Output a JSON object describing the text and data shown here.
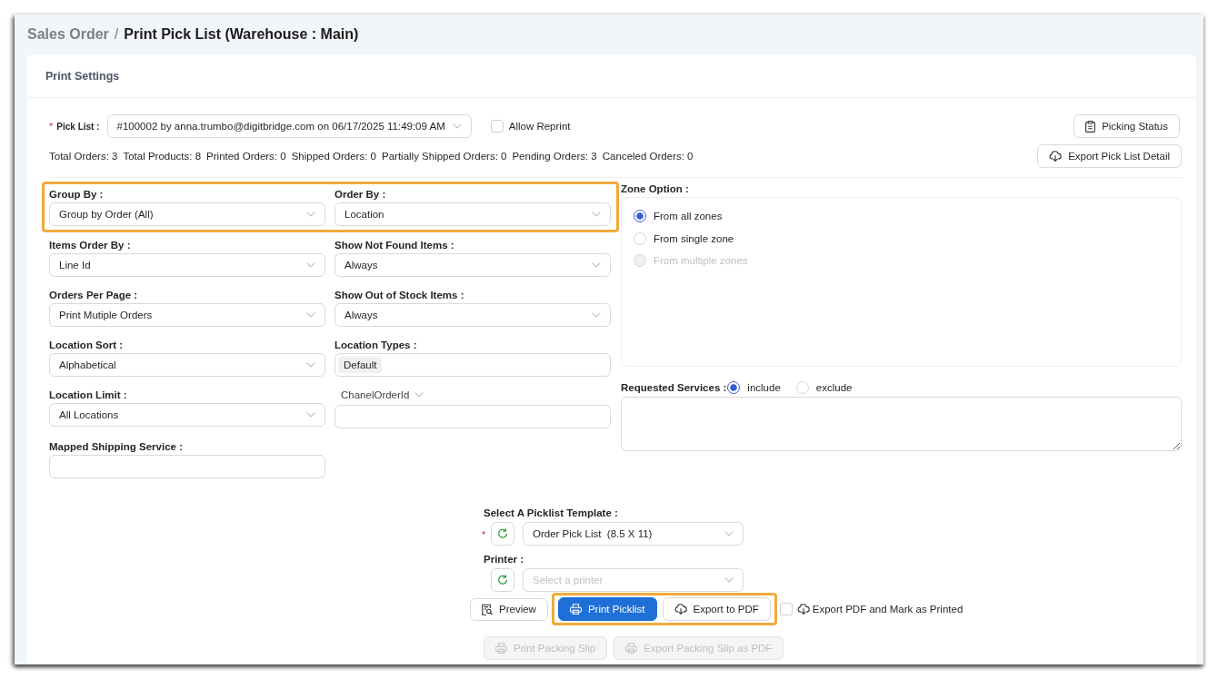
{
  "breadcrumb": {
    "parent": "Sales Order",
    "separator": "/",
    "current": "Print Pick List (Warehouse : Main)"
  },
  "panel": {
    "title": "Print Settings"
  },
  "pick_list": {
    "required_mark": "*",
    "label": "Pick List :",
    "value": "#100002 by anna.trumbo@digitbridge.com on 06/17/2025 11:49:09 AM"
  },
  "allow_reprint": {
    "label": "Allow Reprint",
    "checked": false
  },
  "picking_status_button": {
    "label": "Picking Status"
  },
  "stats": [
    "Total Orders: 3",
    "Total Products: 8",
    "Printed Orders: 0",
    "Shipped Orders: 0",
    "Partially Shipped Orders: 0",
    "Pending Orders: 3",
    "Canceled Orders: 0"
  ],
  "export_detail_button": {
    "label": "Export Pick List Detail"
  },
  "field_groups": [
    {
      "kind": "highlighted",
      "fields": [
        {
          "kind": "select",
          "label": "Group By :",
          "value": "Group by Order (All)"
        },
        {
          "kind": "select",
          "label": "Order By :",
          "value": "Location"
        }
      ]
    },
    {
      "kind": "plain",
      "fields": [
        {
          "kind": "select",
          "label": "Items Order By :",
          "value": "Line Id"
        },
        {
          "kind": "select",
          "label": "Show Not Found Items :",
          "value": "Always"
        },
        {
          "kind": "select",
          "label": "Orders Per Page :",
          "value": "Print Mutiple Orders"
        },
        {
          "kind": "select",
          "label": "Show Out of Stock Items :",
          "value": "Always"
        },
        {
          "kind": "select",
          "label": "Location Sort :",
          "value": "Alphabetical"
        },
        {
          "kind": "tags",
          "label": "Location Types :",
          "tags": [
            "Default"
          ]
        },
        {
          "kind": "select",
          "label": "Location Limit :",
          "value": "All Locations"
        },
        {
          "kind": "picker_input",
          "label": "ChanelOrderId"
        },
        {
          "kind": "input",
          "label": "Mapped Shipping Service :"
        }
      ]
    }
  ],
  "zone_option": {
    "label": "Zone Option :",
    "options": [
      {
        "label": "From all zones",
        "selected": true,
        "disabled": false
      },
      {
        "label": "From single zone",
        "selected": false,
        "disabled": false
      },
      {
        "label": "From multiple zones",
        "selected": false,
        "disabled": true
      }
    ]
  },
  "requested_services": {
    "label": "Requested Services :",
    "options": [
      {
        "label": "include",
        "selected": true
      },
      {
        "label": "exclude",
        "selected": false
      }
    ]
  },
  "template": {
    "label": "Select A Picklist Template :",
    "required_mark": "*",
    "value": "Order Pick List  (8.5 X 11)"
  },
  "printer": {
    "label": "Printer :",
    "placeholder": "Select a printer"
  },
  "actions": [
    {
      "kind": "preview",
      "label": "Preview",
      "primary": false,
      "highlighted": false
    },
    {
      "kind": "print",
      "label": "Print Picklist",
      "primary": true,
      "highlighted": true
    },
    {
      "kind": "export",
      "label": "Export to PDF",
      "primary": false,
      "highlighted": true
    }
  ],
  "export_and_mark": {
    "label": "Export PDF and Mark as Printed",
    "checked": false
  },
  "packing_buttons": [
    {
      "kind": "print",
      "label": "Print Packing Slip",
      "disabled": true
    },
    {
      "kind": "print",
      "label": "Export Packing Slip as PDF",
      "disabled": true
    }
  ]
}
